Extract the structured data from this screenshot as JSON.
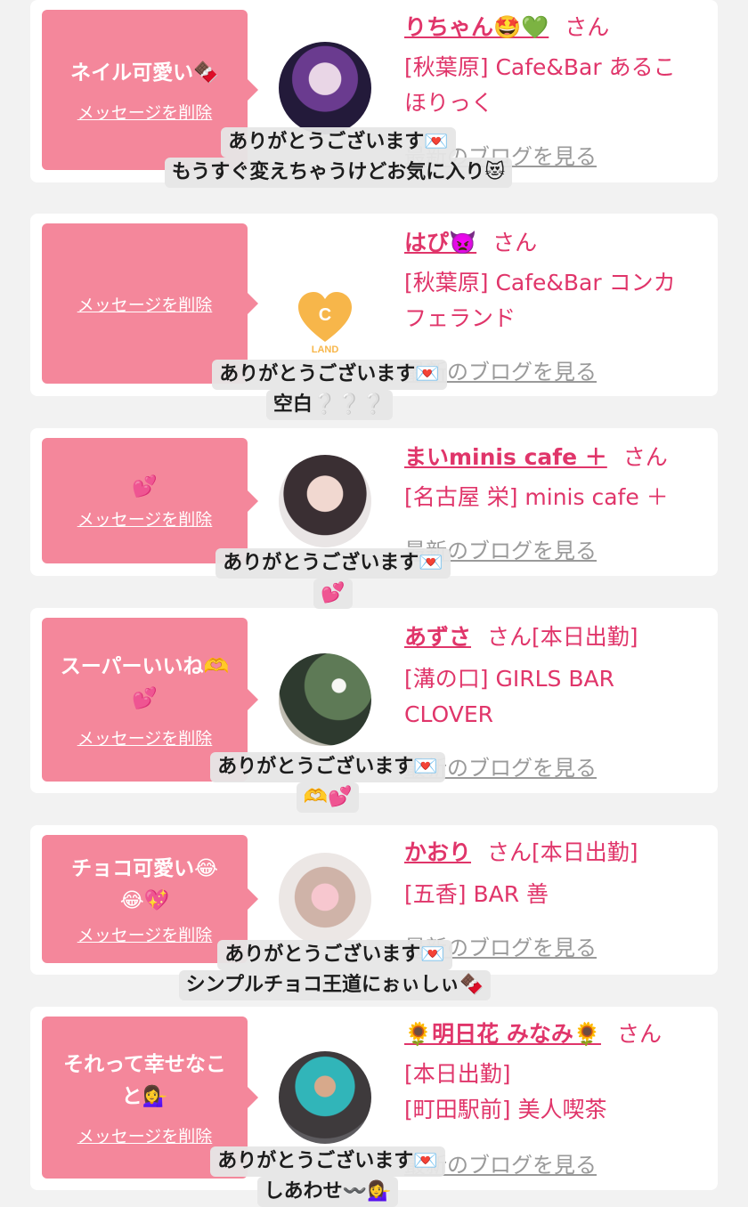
{
  "messages": [
    {
      "bubble_text": "ネイル可愛い🍫",
      "delete_label": "メッセージを削除",
      "name": "りちゃん🤩💚",
      "san": "さん",
      "shop": "[秋葉原] Cafe&Bar あるこ\nほりっく",
      "blog": "最新のブログを見る",
      "caption": [
        "ありがとうございます💌",
        "もうすぐ変えちゃうけどお気に入り😻"
      ]
    },
    {
      "bubble_text": "",
      "delete_label": "メッセージを削除",
      "name": "はぴ👿",
      "san": "さん",
      "shop": "[秋葉原] Cafe&Bar コンカ\nフェランド",
      "blog": "最新のブログを見る",
      "logo_letter": "C",
      "logo_word": "LAND",
      "caption": [
        "ありがとうございます💌",
        "空白❔❔❔"
      ]
    },
    {
      "bubble_text": "💕",
      "delete_label": "メッセージを削除",
      "name": "まいminis cafe ＋",
      "san": "さん",
      "shop": "[名古屋 栄] minis cafe ＋",
      "blog": "最新のブログを見る",
      "caption": [
        "ありがとうございます💌",
        "💕"
      ]
    },
    {
      "bubble_text": "スーパーいいね🫶\n💕",
      "delete_label": "メッセージを削除",
      "name": "あずさ",
      "san": "さん[本日出勤]",
      "shop": "[溝の口] GIRLS BAR\nCLOVER",
      "blog": "最新のブログを見る",
      "caption": [
        "ありがとうございます💌",
        "🫶💕"
      ]
    },
    {
      "bubble_text": "チョコ可愛い😂\n😂💖",
      "delete_label": "メッセージを削除",
      "name": "かおり",
      "san": "さん[本日出勤]",
      "shop": "[五香] BAR 善",
      "blog": "最新のブログを見る",
      "caption": [
        "ありがとうございます💌",
        "シンプルチョコ王道にぉぃしぃ🍫"
      ]
    },
    {
      "bubble_text": "それって幸せなこ\nと💁‍♀️",
      "delete_label": "メッセージを削除",
      "name": "🌻明日花 みなみ🌻",
      "san": "さん",
      "shop": "[本日出勤]\n[町田駅前] 美人喫茶",
      "blog": "最新のブログを見る",
      "caption": [
        "ありがとうございます💌",
        "しあわせ〰️💁‍♀️"
      ]
    }
  ],
  "colors": {
    "bubble": "#f4879b",
    "accent": "#e0356a",
    "blog_link": "#9a9a9a",
    "background": "#f2f2f2",
    "caption_bg": "#e6e6e6"
  }
}
